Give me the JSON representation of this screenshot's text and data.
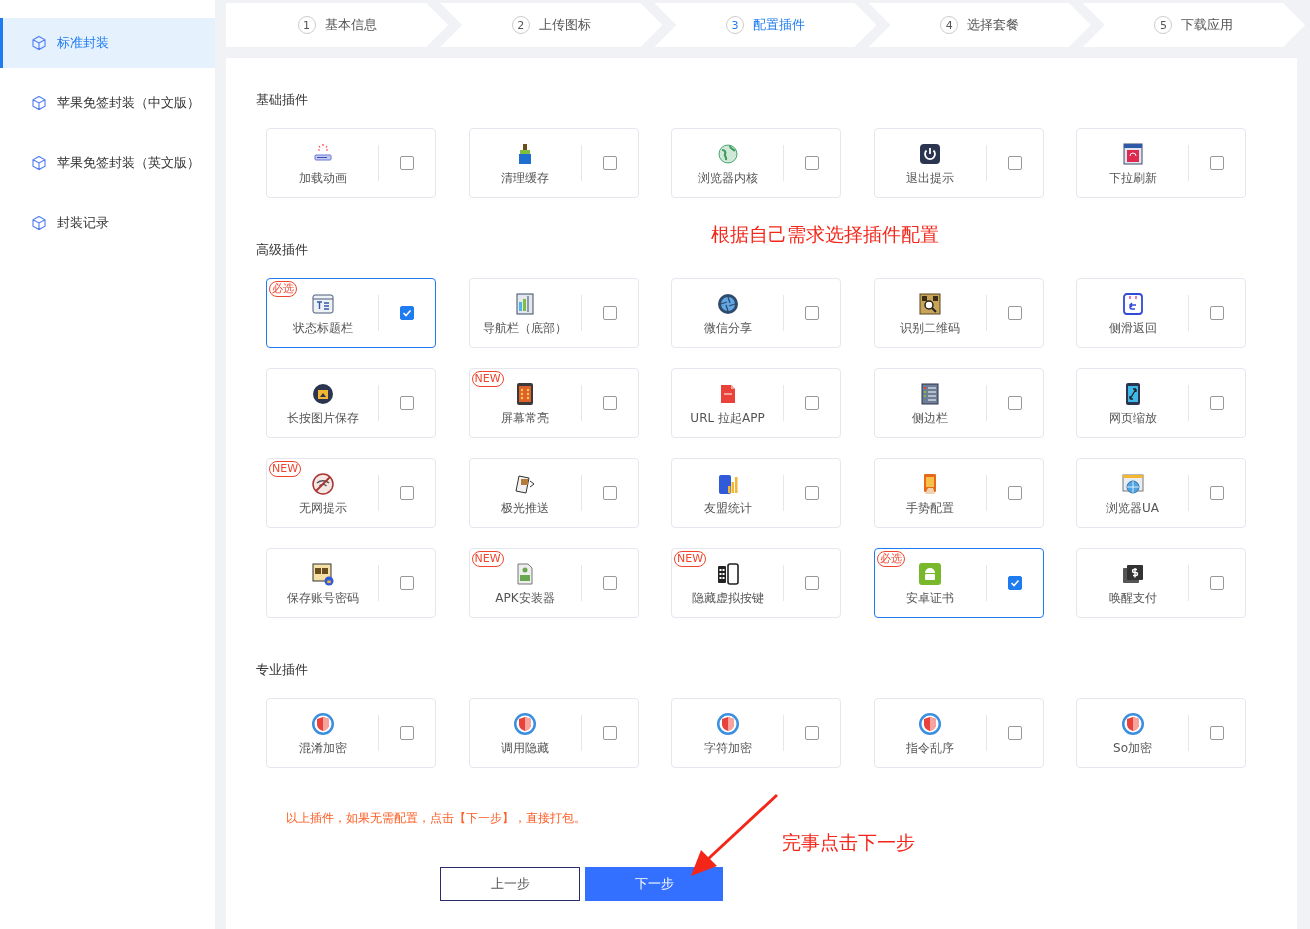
{
  "sidebar": {
    "items": [
      {
        "label": "标准封装",
        "selected": true
      },
      {
        "label": "苹果免签封装（中文版）",
        "selected": false
      },
      {
        "label": "苹果免签封装（英文版）",
        "selected": false
      },
      {
        "label": "封装记录",
        "selected": false
      }
    ]
  },
  "steps": [
    {
      "number": "1",
      "label": "基本信息",
      "selected": false
    },
    {
      "number": "2",
      "label": "上传图标",
      "selected": false
    },
    {
      "number": "3",
      "label": "配置插件",
      "selected": true
    },
    {
      "number": "4",
      "label": "选择套餐",
      "selected": false
    },
    {
      "number": "5",
      "label": "下载应用",
      "selected": false
    }
  ],
  "sections": [
    {
      "title": "基础插件",
      "plugins": [
        {
          "label": "加载动画",
          "checked": false
        },
        {
          "label": "清理缓存",
          "checked": false
        },
        {
          "label": "浏览器内核",
          "checked": false
        },
        {
          "label": "退出提示",
          "checked": false
        },
        {
          "label": "下拉刷新",
          "checked": false
        }
      ]
    },
    {
      "title": "高级插件",
      "plugins": [
        {
          "label": "状态标题栏",
          "checked": true,
          "badge": "必选"
        },
        {
          "label": "导航栏（底部）",
          "checked": false
        },
        {
          "label": "微信分享",
          "checked": false
        },
        {
          "label": "识别二维码",
          "checked": false
        },
        {
          "label": "侧滑返回",
          "checked": false
        },
        {
          "label": "长按图片保存",
          "checked": false
        },
        {
          "label": "屏幕常亮",
          "checked": false,
          "badge": "NEW"
        },
        {
          "label": "URL 拉起APP",
          "checked": false
        },
        {
          "label": "侧边栏",
          "checked": false
        },
        {
          "label": "网页缩放",
          "checked": false
        },
        {
          "label": "无网提示",
          "checked": false,
          "badge": "NEW"
        },
        {
          "label": "极光推送",
          "checked": false
        },
        {
          "label": "友盟统计",
          "checked": false
        },
        {
          "label": "手势配置",
          "checked": false
        },
        {
          "label": "浏览器UA",
          "checked": false
        },
        {
          "label": "保存账号密码",
          "checked": false
        },
        {
          "label": "APK安装器",
          "checked": false,
          "badge": "NEW"
        },
        {
          "label": "隐藏虚拟按键",
          "checked": false,
          "badge": "NEW"
        },
        {
          "label": "安卓证书",
          "checked": true,
          "badge": "必选"
        },
        {
          "label": "唤醒支付",
          "checked": false
        }
      ]
    },
    {
      "title": "专业插件",
      "plugins": [
        {
          "label": "混淆加密",
          "checked": false
        },
        {
          "label": "调用隐藏",
          "checked": false
        },
        {
          "label": "字符加密",
          "checked": false
        },
        {
          "label": "指令乱序",
          "checked": false
        },
        {
          "label": "So加密",
          "checked": false
        }
      ]
    }
  ],
  "note": "以上插件，如果无需配置，点击【下一步】，直接打包。",
  "buttons": [
    {
      "label": "上一步",
      "kind": "secondary"
    },
    {
      "label": "下一步",
      "kind": "primary"
    }
  ],
  "annotations": [
    {
      "text": "根据自己需求选择插件配置"
    },
    {
      "text": "完事点击下一步"
    }
  ]
}
